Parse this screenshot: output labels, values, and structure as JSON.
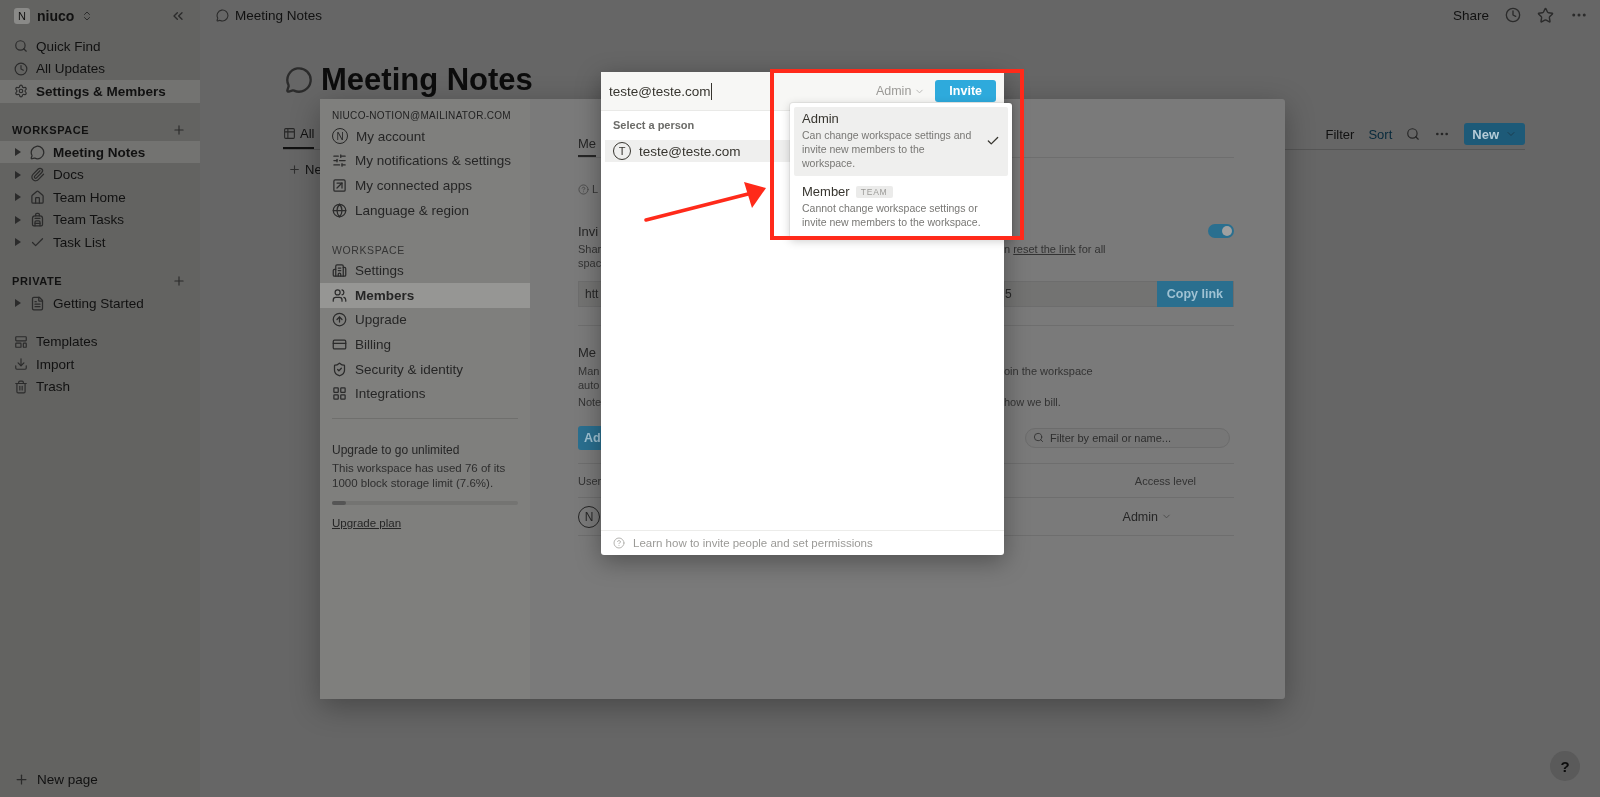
{
  "sidebar": {
    "workspace": {
      "initial": "N",
      "name": "niuco"
    },
    "nav": [
      {
        "label": "Quick Find",
        "selected": false
      },
      {
        "label": "All Updates",
        "selected": false
      },
      {
        "label": "Settings & Members",
        "selected": true
      }
    ],
    "sections": [
      {
        "title": "WORKSPACE",
        "pages": [
          {
            "label": "Meeting Notes",
            "selected": true
          },
          {
            "label": "Docs",
            "selected": false
          },
          {
            "label": "Team Home",
            "selected": false
          },
          {
            "label": "Team Tasks",
            "selected": false
          },
          {
            "label": "Task List",
            "selected": false
          }
        ]
      },
      {
        "title": "PRIVATE",
        "pages": [
          {
            "label": "Getting Started",
            "selected": false
          }
        ]
      }
    ],
    "tools": [
      "Templates",
      "Import",
      "Trash"
    ],
    "new_page": "New page"
  },
  "topbar": {
    "breadcrumb": "Meeting Notes",
    "share": "Share"
  },
  "page": {
    "title": "Meeting Notes",
    "view_tab": "All",
    "actions": [
      "Filter",
      "Sort"
    ],
    "new_button": "New",
    "new_row": "Ne"
  },
  "settings": {
    "account_email": "NIUCO-NOTION@MAILINATOR.COM",
    "account_initial": "N",
    "account_items": [
      {
        "label": "My account",
        "selected": false
      },
      {
        "label": "My notifications & settings",
        "selected": false
      },
      {
        "label": "My connected apps",
        "selected": false
      },
      {
        "label": "Language & region",
        "selected": false
      }
    ],
    "workspace_title": "WORKSPACE",
    "workspace_items": [
      {
        "label": "Settings",
        "selected": false
      },
      {
        "label": "Members",
        "selected": true
      },
      {
        "label": "Upgrade",
        "selected": false
      },
      {
        "label": "Billing",
        "selected": false
      },
      {
        "label": "Security & identity",
        "selected": false
      },
      {
        "label": "Integrations",
        "selected": false
      }
    ],
    "upgrade": {
      "title": "Upgrade to go unlimited",
      "text": "This workspace has used 76 of its 1000 block storage limit (7.6%).",
      "level": 0.076,
      "link": "Upgrade plan"
    },
    "content": {
      "tab": "Me",
      "hint": "L",
      "invite_title": "Invi",
      "invite_text": [
        "Shar",
        "spac"
      ],
      "invite_text_end": "n ",
      "reset_link": "reset the link",
      "invite_text_tail": " for all",
      "invite_link_on": true,
      "link_start": "htt",
      "link_end": "5",
      "copy_button": "Copy link",
      "members_title": "Me",
      "members_text": [
        "Man",
        "auto"
      ],
      "members_text_end": "oin the workspace",
      "note": "Note",
      "note_end": "how we bill.",
      "add_button": "Ad",
      "filter_placeholder": "Filter by email or name...",
      "col_user": "User",
      "col_access": "Access level",
      "member_initial": "N",
      "member_access": "Admin"
    }
  },
  "invite": {
    "input": "teste@teste.com",
    "role": "Admin",
    "invite_button": "Invite",
    "section_title": "Select a person",
    "people": [
      {
        "initial": "T",
        "email": "teste@teste.com",
        "selected": true
      }
    ],
    "footer": "Learn how to invite people and set permissions"
  },
  "role_menu": {
    "options": [
      {
        "label": "Admin",
        "description": "Can change workspace settings and invite new members to the workspace.",
        "selected": true
      },
      {
        "label": "Member",
        "badge": "TEAM",
        "description": "Cannot change workspace settings or invite new members to the workspace.",
        "selected": false
      }
    ]
  },
  "annotations": {
    "highlight_box": true,
    "arrow": true
  },
  "help": "?"
}
